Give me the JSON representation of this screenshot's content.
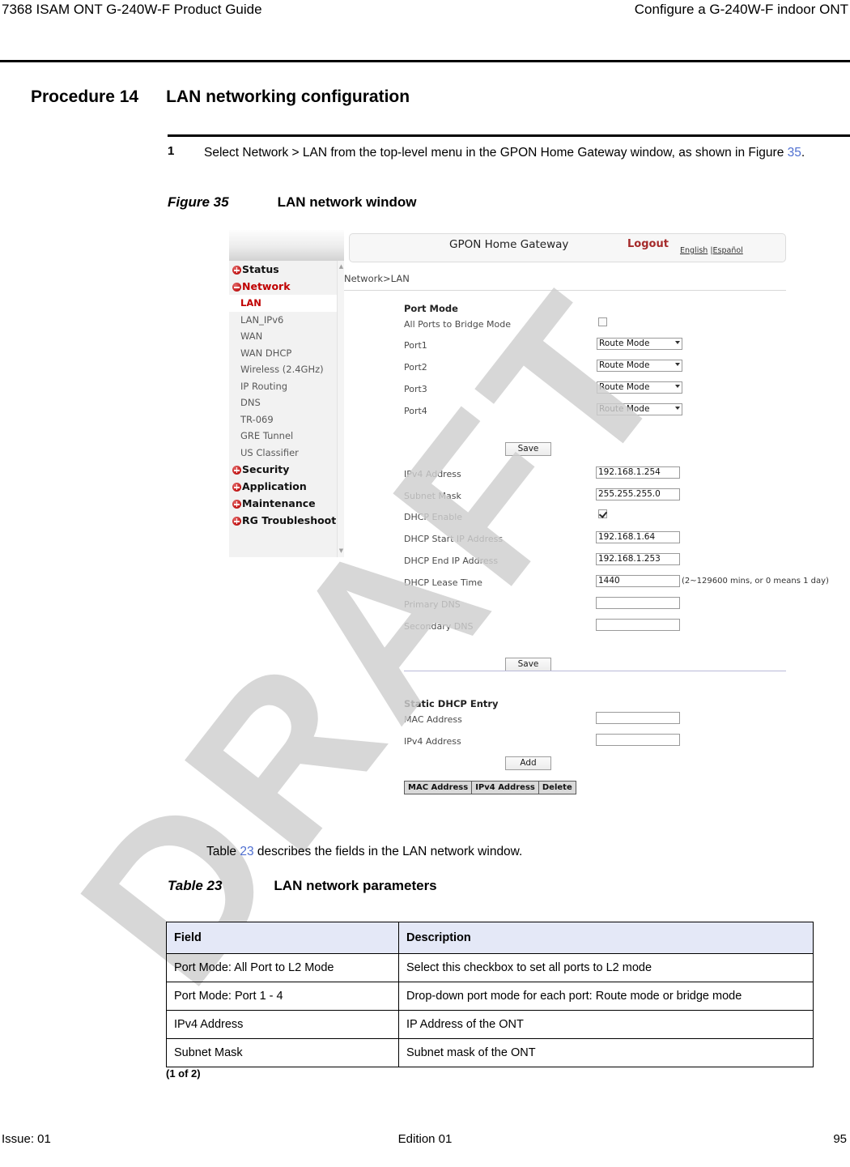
{
  "running_header": {
    "left": "7368 ISAM ONT G-240W-F Product Guide",
    "right": "Configure a G-240W-F indoor ONT"
  },
  "procedure": {
    "number": "Procedure 14",
    "title": "LAN networking configuration",
    "step_number": "1",
    "step_text_before": "Select Network > LAN from the top-level menu in the GPON Home Gateway window, as shown in Figure ",
    "step_xref": "35",
    "step_text_after": "."
  },
  "figure": {
    "number": "Figure 35",
    "title": "LAN network window"
  },
  "watermark": "DRAFT",
  "app": {
    "title": "GPON Home Gateway",
    "logout": "Logout",
    "lang_english": "English",
    "lang_separator": " |",
    "lang_espanol": "Español",
    "breadcrumb": "Network>LAN",
    "sidebar": {
      "top_items": [
        {
          "label": "Status",
          "state": "collapsed"
        },
        {
          "label": "Network",
          "state": "expanded"
        },
        {
          "label": "Security",
          "state": "collapsed"
        },
        {
          "label": "Application",
          "state": "collapsed"
        },
        {
          "label": "Maintenance",
          "state": "collapsed"
        },
        {
          "label": "RG Troubleshooting",
          "state": "collapsed"
        }
      ],
      "network_children": [
        "LAN",
        "LAN_IPv6",
        "WAN",
        "WAN DHCP",
        "Wireless (2.4GHz)",
        "IP Routing",
        "DNS",
        "TR-069",
        "GRE Tunnel",
        "US Classifier"
      ],
      "selected_child": "LAN",
      "scroll_up_icon": "scroll-up-arrow",
      "scroll_down_icon": "scroll-down-arrow"
    },
    "port_mode": {
      "heading": "Port Mode",
      "all_bridge_label": "All Ports to Bridge Mode",
      "all_bridge_checked": false,
      "ports": [
        {
          "label": "Port1",
          "value": "Route Mode"
        },
        {
          "label": "Port2",
          "value": "Route Mode"
        },
        {
          "label": "Port3",
          "value": "Route Mode"
        },
        {
          "label": "Port4",
          "value": "Route Mode"
        }
      ],
      "save_label": "Save"
    },
    "lan_settings": {
      "fields": [
        {
          "label": "IPv4 Address",
          "value": "192.168.1.254"
        },
        {
          "label": "Subnet Mask",
          "value": "255.255.255.0"
        }
      ],
      "dhcp_enable_label": "DHCP Enable",
      "dhcp_enable_checked": true,
      "dhcp_fields": [
        {
          "label": "DHCP Start IP Address",
          "value": "192.168.1.64"
        },
        {
          "label": "DHCP End IP Address",
          "value": "192.168.1.253"
        }
      ],
      "lease_label": "DHCP Lease Time",
      "lease_value": "1440",
      "lease_hint": "(2~129600 mins, or 0 means 1 day)",
      "dns_fields": [
        {
          "label": "Primary DNS",
          "value": ""
        },
        {
          "label": "Secondary DNS",
          "value": ""
        }
      ],
      "save_label": "Save"
    },
    "static_dhcp": {
      "heading": "Static DHCP Entry",
      "mac_label": "MAC Address",
      "mac_value": "",
      "ipv4_label": "IPv4 Address",
      "ipv4_value": "",
      "add_label": "Add",
      "grid_columns": [
        "MAC Address",
        "IPv4 Address",
        "Delete"
      ]
    }
  },
  "table_intro": {
    "before": "Table ",
    "xref": "23",
    "after": " describes the fields in the LAN network window."
  },
  "table": {
    "caption_number": "Table 23",
    "caption_title": "LAN network parameters",
    "headers": [
      "Field",
      "Description"
    ],
    "rows": [
      [
        "Port Mode: All Port to L2 Mode",
        "Select this checkbox to set all ports to L2 mode"
      ],
      [
        "Port Mode: Port 1 - 4",
        "Drop-down port mode for each port: Route mode or bridge mode"
      ],
      [
        "IPv4 Address",
        "IP Address of the ONT"
      ],
      [
        "Subnet Mask",
        "Subnet mask of the ONT"
      ]
    ],
    "continuation": "(1 of 2)"
  },
  "footer": {
    "left": "Issue: 01",
    "center": "Edition 01",
    "right": "95"
  },
  "colors": {
    "xref_blue": "#4f6fd0",
    "table_header_bg": "#e4e8f7",
    "accent_red": "#c00000",
    "watermark_gray": "#cfcfcf"
  }
}
